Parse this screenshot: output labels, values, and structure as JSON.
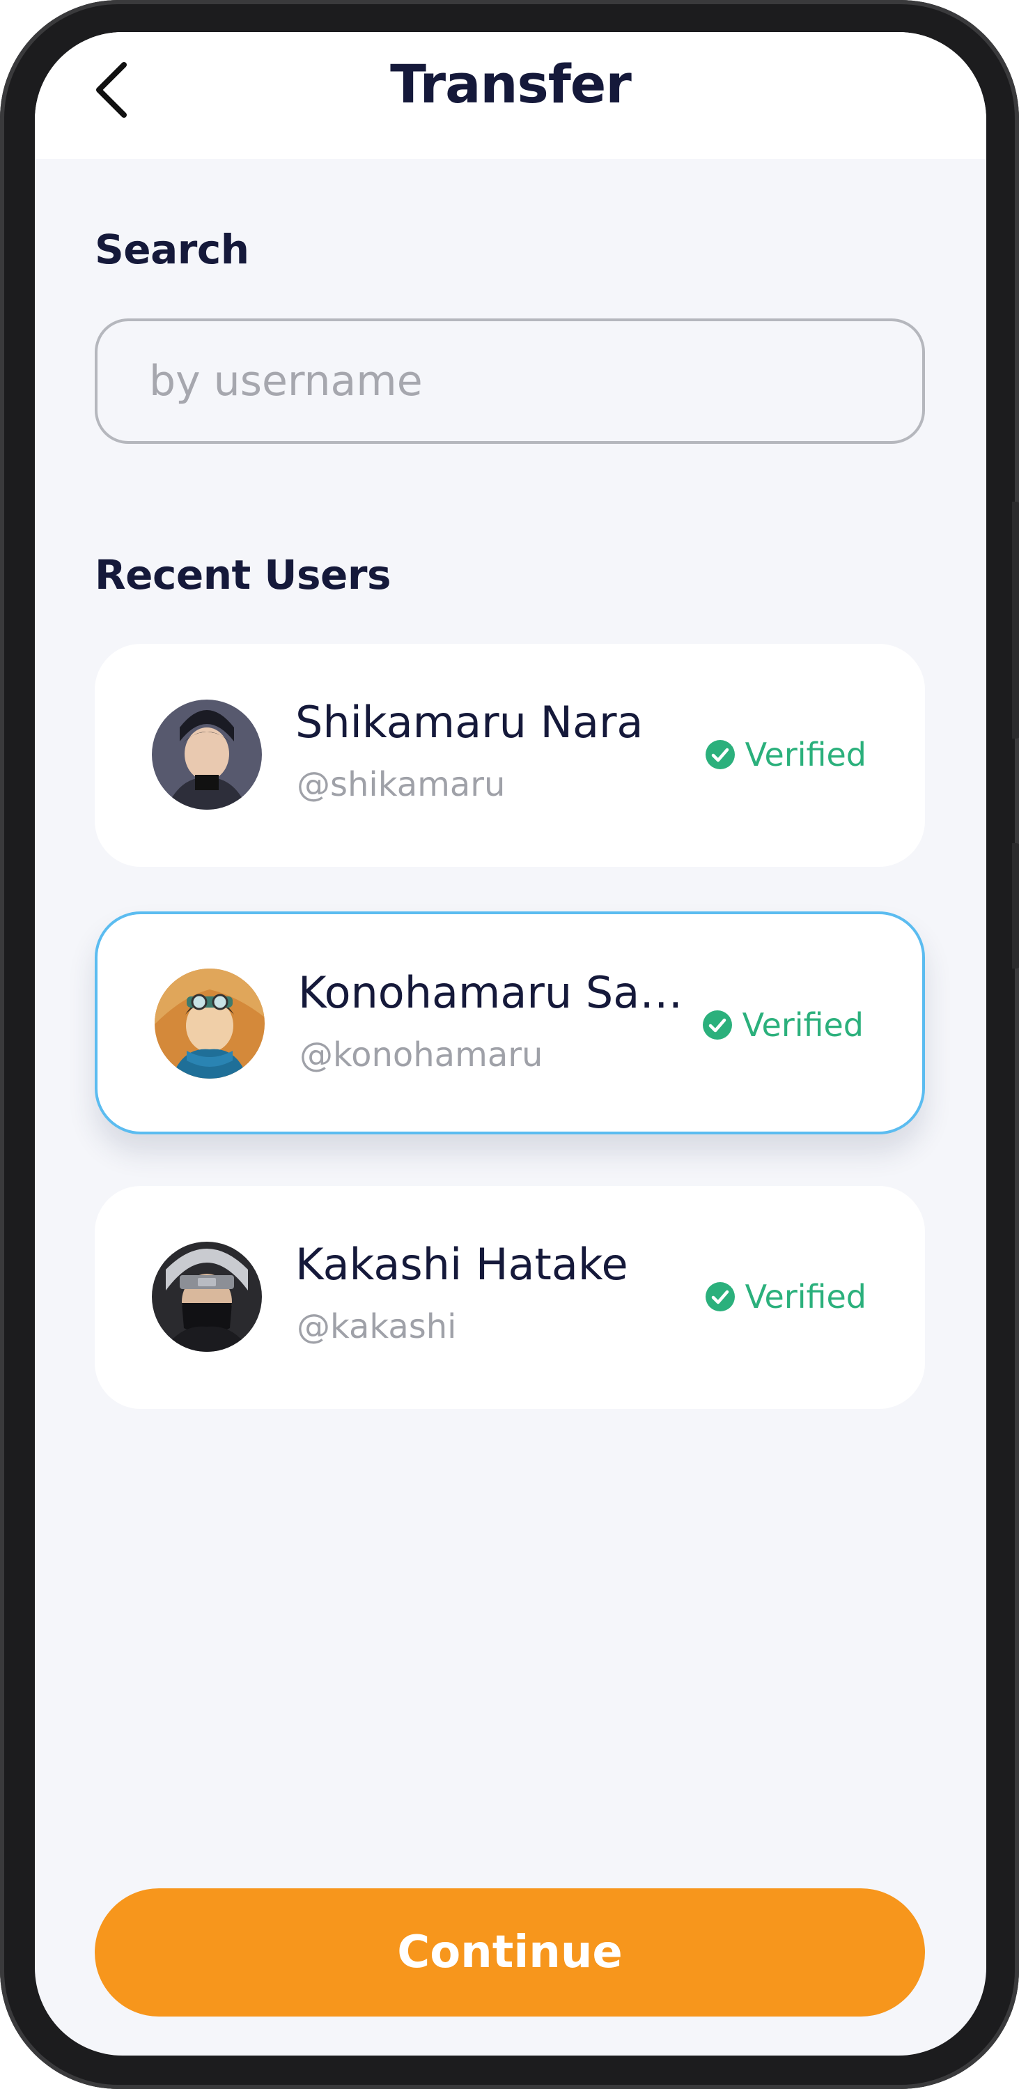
{
  "header": {
    "title": "Transfer",
    "back_icon": "chevron-left-icon"
  },
  "search": {
    "label": "Search",
    "placeholder": "by username",
    "value": ""
  },
  "recent": {
    "label": "Recent Users",
    "users": [
      {
        "name": "Shikamaru Nara",
        "handle": "@shikamaru",
        "status": "Verified",
        "selected": false
      },
      {
        "name": "Konohamaru Sarutobi",
        "handle": "@konohamaru",
        "status": "Verified",
        "selected": true
      },
      {
        "name": "Kakashi Hatake",
        "handle": "@kakashi",
        "status": "Verified",
        "selected": false
      }
    ]
  },
  "footer": {
    "continue_label": "Continue"
  },
  "colors": {
    "accent": "#f7961c",
    "verified": "#2bb07c",
    "selected_border": "#5bbcf0",
    "title_text": "#15193a",
    "background": "#f5f6fa"
  }
}
